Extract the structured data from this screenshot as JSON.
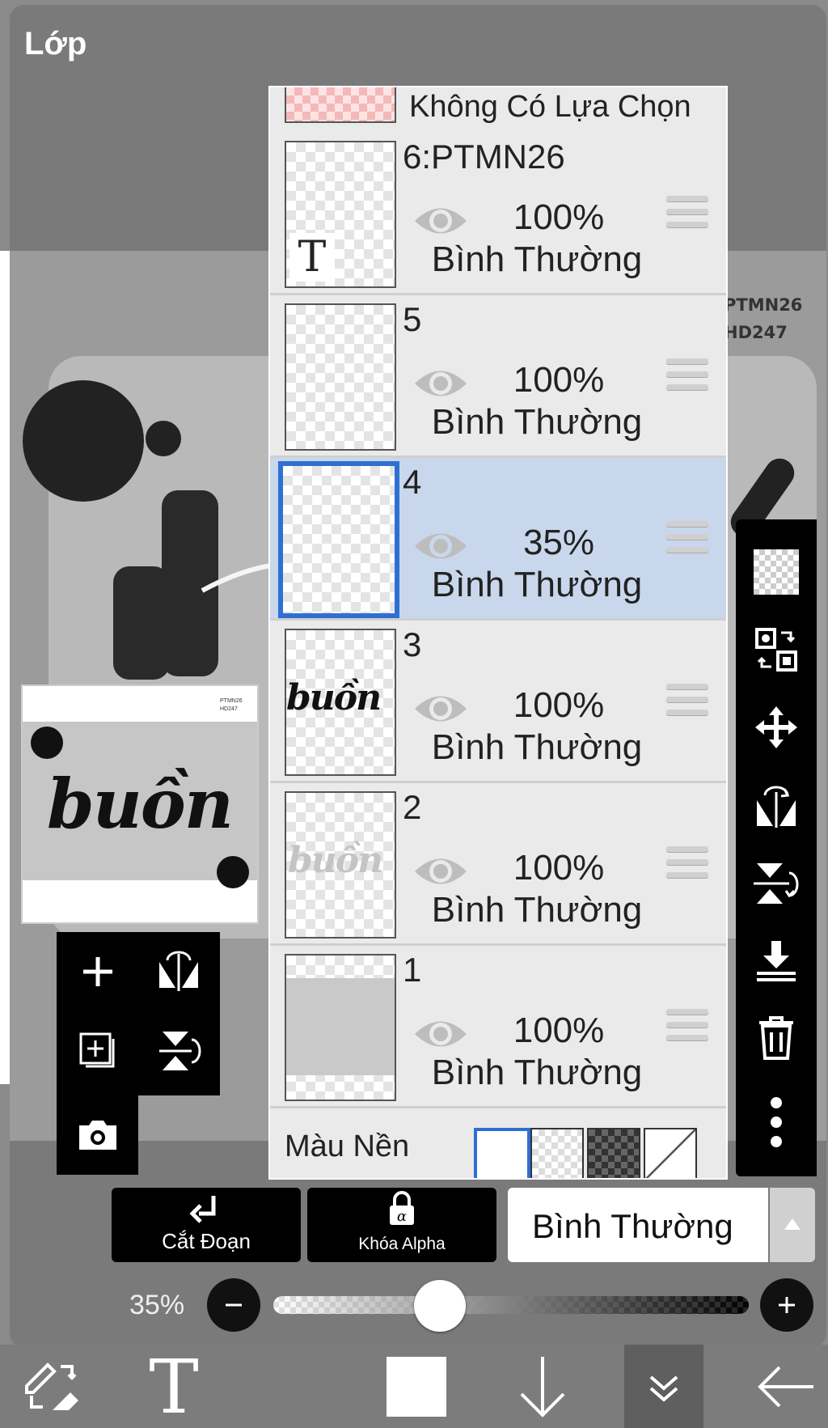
{
  "panel_title": "Lớp",
  "canvas_text": [
    "PTMN26",
    "HD247"
  ],
  "preview": {
    "word": "buồn",
    "corner": [
      "PTMN26",
      "HD247"
    ]
  },
  "no_selection_label": "Không Có Lựa Chọn",
  "layers": [
    {
      "name": "6:PTMN26",
      "opacity": "100%",
      "mode": "Bình Thường",
      "selected": false,
      "thumb_text": "T"
    },
    {
      "name": "5",
      "opacity": "100%",
      "mode": "Bình Thường",
      "selected": false
    },
    {
      "name": "4",
      "opacity": "35%",
      "mode": "Bình Thường",
      "selected": true
    },
    {
      "name": "3",
      "opacity": "100%",
      "mode": "Bình Thường",
      "selected": false,
      "thumb_text": "buồn"
    },
    {
      "name": "2",
      "opacity": "100%",
      "mode": "Bình Thường",
      "selected": false,
      "thumb_text": "buồn"
    },
    {
      "name": "1",
      "opacity": "100%",
      "mode": "Bình Thường",
      "selected": false
    }
  ],
  "background": {
    "label": "Màu Nền",
    "options": [
      "white",
      "transparent",
      "dark-checker",
      "diagonal"
    ],
    "selected": "white"
  },
  "right_tools": [
    "transparency-icon",
    "transfer-icon",
    "move-icon",
    "flip-horizontal-icon",
    "flip-vertical-icon",
    "merge-down-icon",
    "delete-icon",
    "more-icon"
  ],
  "left_tools": [
    "add-layer-icon",
    "flip-icon",
    "duplicate-layer-icon",
    "flip-vertical-icon",
    "camera-icon"
  ],
  "actions": {
    "clip": "Cắt Đoạn",
    "alpha_lock": "Khóa Alpha",
    "blend_mode": "Bình Thường"
  },
  "opacity": {
    "label": "35%",
    "value": 0.35
  },
  "bottom_toolbar": [
    "swap-tool-icon",
    "text-icon",
    "color-swatch",
    "arrow-down-icon",
    "collapse-icon",
    "back-icon"
  ],
  "colors": {
    "selected_layer": "#c9d7ec",
    "selected_border": "#2f6fd2",
    "panel_bg": "#eaeaea"
  }
}
